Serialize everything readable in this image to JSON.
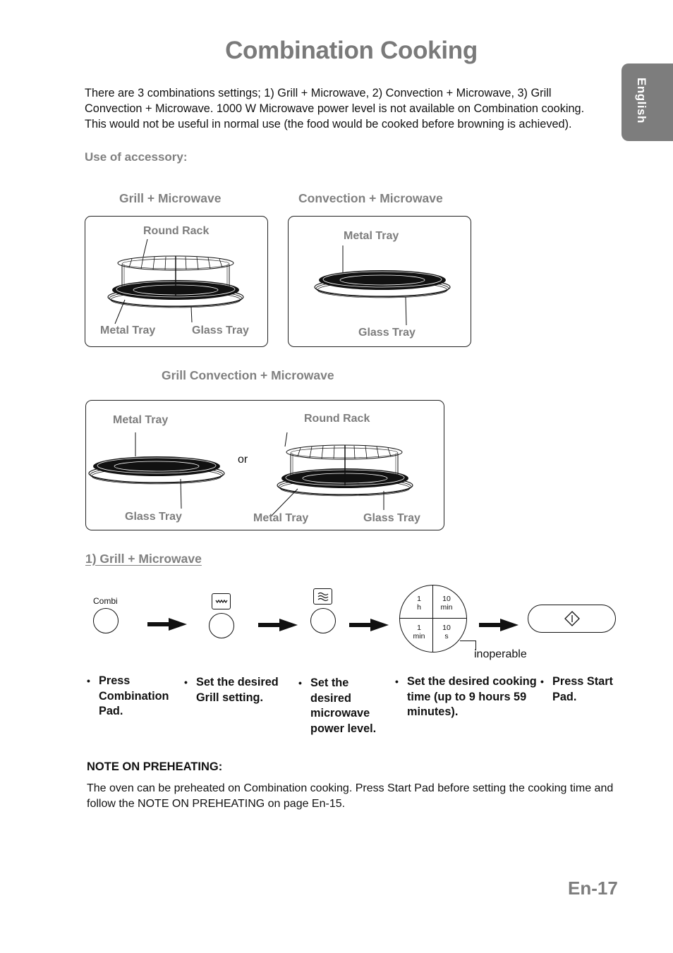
{
  "page": {
    "title": "Combination Cooking",
    "language_tab": "English",
    "intro": "There are 3 combinations settings; 1) Grill + Microwave, 2) Convection + Microwave, 3) Grill Convection + Microwave. 1000 W Microwave power level is not available on Combination cooking. This would not be useful in normal use (the food would be cooked before browning is achieved).",
    "page_number": "En-17"
  },
  "accessory": {
    "heading": "Use of accessory:",
    "grill_microwave": {
      "title": "Grill + Microwave",
      "labels": {
        "round_rack": "Round Rack",
        "metal_tray": "Metal Tray",
        "glass_tray": "Glass Tray"
      }
    },
    "convection_microwave": {
      "title": "Convection + Microwave",
      "labels": {
        "metal_tray": "Metal Tray",
        "glass_tray": "Glass Tray"
      }
    },
    "grill_convection_microwave": {
      "title": "Grill Convection + Microwave",
      "left_labels": {
        "metal_tray": "Metal Tray",
        "glass_tray": "Glass Tray"
      },
      "or": "or",
      "right_labels": {
        "round_rack": "Round Rack",
        "metal_tray": "Metal Tray",
        "glass_tray": "Glass Tray"
      }
    }
  },
  "procedure": {
    "heading": "1) Grill + Microwave",
    "combi_label": "Combi",
    "icons": {
      "combi_pad": "circle-button-icon",
      "grill_pad": "grill-element-icon",
      "microwave_pad": "microwave-waves-icon",
      "time_dial": "time-dial-icon",
      "start_pad": "start-diamond-icon",
      "arrow": "right-arrow-icon"
    },
    "dial": {
      "top_left": [
        "1",
        "h"
      ],
      "top_right": [
        "10",
        "min"
      ],
      "bottom_left": [
        "1",
        "min"
      ],
      "bottom_right": [
        "10",
        "s"
      ],
      "callout": "inoperable"
    },
    "steps": [
      {
        "bullet": "•",
        "text": "Press Combination Pad."
      },
      {
        "bullet": "•",
        "text": "Set the desired Grill setting."
      },
      {
        "bullet": "•",
        "text": "Set the desired microwave power level."
      },
      {
        "bullet": "•",
        "text": "Set the desired cooking time (up to 9 hours 59 minutes)."
      },
      {
        "bullet": "•",
        "text": "Press Start Pad."
      }
    ]
  },
  "note": {
    "heading": "NOTE ON PREHEATING:",
    "body": "The oven can be preheated on Combination cooking. Press Start Pad before setting the cooking time and follow the NOTE ON PREHEATING on page En-15."
  },
  "colors": {
    "heading_gray": "#7a7a7a",
    "tab_gray": "#7d7d7d",
    "text": "#111111"
  }
}
